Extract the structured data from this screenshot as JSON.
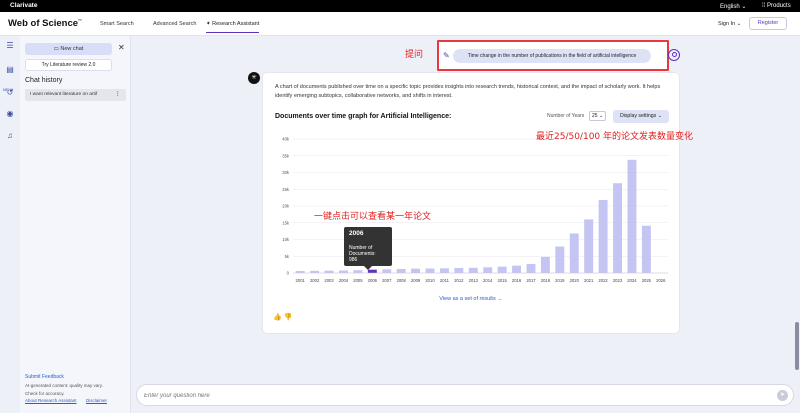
{
  "topbar": {
    "brand": "Clarivate",
    "language": "English",
    "products": "Products"
  },
  "nav": {
    "logo": "Web of Science",
    "logo_tm": "™",
    "tabs": [
      "Smart Search",
      "Advanced Search",
      "Research Assistant"
    ],
    "sign_in": "Sign In",
    "register": "Register"
  },
  "rail": {
    "menu_label": "MENU"
  },
  "sidebar": {
    "new_chat": "New chat",
    "lit_review": "Try Literature review 2.0",
    "history_heading": "Chat history",
    "history_items": [
      "I want relevant literature on artif"
    ],
    "feedback": "Submit Feedback",
    "note1": "AI-generated content: quality may vary.",
    "note2": "Check for accuracy.",
    "about": "About Research Assistant",
    "disclaimer": "Disclaimer"
  },
  "conversation": {
    "ask_annotation": "提问",
    "question": "Time change in the number of publications in the field of artificial intelligence",
    "answer_intro": "A chart of documents published over time on a specific topic provides insights into research trends, historical context, and the impact of scholarly work. It helps identify emerging subtopics, collaborative networks, and shifts in interest.",
    "chart_title": "Documents over time graph for Artificial Intelligence:",
    "years_label": "Number of Years",
    "years_value": "25",
    "display_settings": "Display settings",
    "view_results": "View as a set of results →",
    "annotation_years": "最近25/50/100 年的论文发表数量变化",
    "annotation_click": "一键点击可以查看某一年论文"
  },
  "tooltip": {
    "year": "2006",
    "label": "Number of Documents:",
    "value": "986"
  },
  "input": {
    "placeholder": "Enter your question here"
  },
  "chart_data": {
    "type": "bar",
    "title": "Documents over time graph for Artificial Intelligence:",
    "categories": [
      "2001",
      "2002",
      "2003",
      "2004",
      "2005",
      "2006",
      "2007",
      "2008",
      "2009",
      "2010",
      "2011",
      "2012",
      "2013",
      "2014",
      "2015",
      "2016",
      "2017",
      "2018",
      "2019",
      "2020",
      "2021",
      "2022",
      "2023",
      "2024",
      "2025",
      "2026"
    ],
    "values": [
      600,
      650,
      700,
      750,
      850,
      986,
      1100,
      1200,
      1300,
      1350,
      1400,
      1500,
      1550,
      1700,
      1900,
      2200,
      2700,
      4800,
      7900,
      11800,
      16000,
      21800,
      26800,
      33800,
      14100,
      0
    ],
    "highlight_index": 5,
    "yticks": [
      "0",
      "5k",
      "10k",
      "15k",
      "20k",
      "25k",
      "30k",
      "35k",
      "40k"
    ],
    "ylim": [
      0,
      40000
    ],
    "bar_color": "#c5c5f4",
    "highlight_color": "#5e33bf",
    "grid": true
  }
}
